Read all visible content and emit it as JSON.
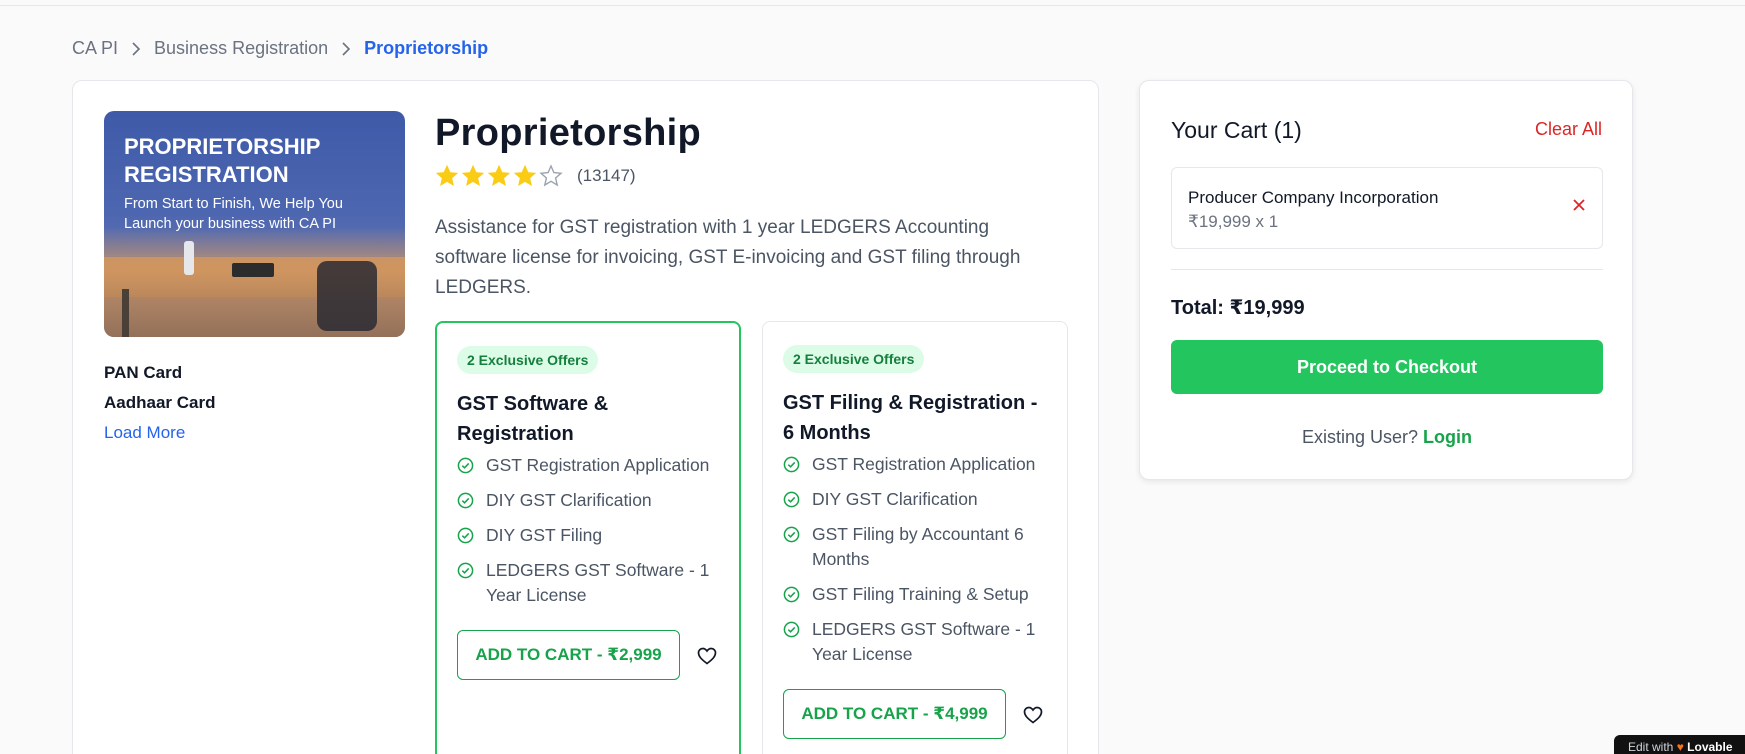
{
  "breadcrumb": {
    "items": [
      "CA PI",
      "Business Registration",
      "Proprietorship"
    ]
  },
  "hero": {
    "title": "PROPRIETORSHIP REGISTRATION",
    "subtitle": "From Start to Finish, We Help You Launch your business with CA PI"
  },
  "documents": {
    "items": [
      "PAN Card",
      "Aadhaar Card"
    ],
    "load_more": "Load More"
  },
  "product": {
    "title": "Proprietorship",
    "rating": 4,
    "rating_max": 5,
    "review_count": "(13147)",
    "description": "Assistance for GST registration with 1 year LEDGERS Accounting software license for invoicing, GST E-invoicing and GST filing through LEDGERS."
  },
  "plans": [
    {
      "offers": "2 Exclusive Offers",
      "title": "GST Software & Registration",
      "features": [
        "GST Registration Application",
        "DIY GST Clarification",
        "DIY GST Filing",
        "LEDGERS GST Software - 1 Year License"
      ],
      "button": "ADD TO CART - ₹2,999",
      "selected": true
    },
    {
      "offers": "2 Exclusive Offers",
      "title": "GST Filing & Registration - 6 Months",
      "features": [
        "GST Registration Application",
        "DIY GST Clarification",
        "GST Filing by Accountant 6 Months",
        "GST Filing Training & Setup",
        "LEDGERS GST Software - 1 Year License"
      ],
      "button": "ADD TO CART - ₹4,999",
      "selected": false
    }
  ],
  "cart": {
    "title": "Your Cart (1)",
    "clear_all": "Clear All",
    "items": [
      {
        "name": "Producer Company Incorporation",
        "price": "₹19,999 x 1"
      }
    ],
    "total": "Total: ₹19,999",
    "checkout": "Proceed to Checkout",
    "existing_user": "Existing User?",
    "login": "Login"
  },
  "badge": {
    "text": "Edit with",
    "brand": "Lovable"
  },
  "colors": {
    "accent_green": "#22c55e",
    "link_blue": "#2563eb",
    "danger_red": "#dc2626",
    "star_yellow": "#facc15"
  }
}
